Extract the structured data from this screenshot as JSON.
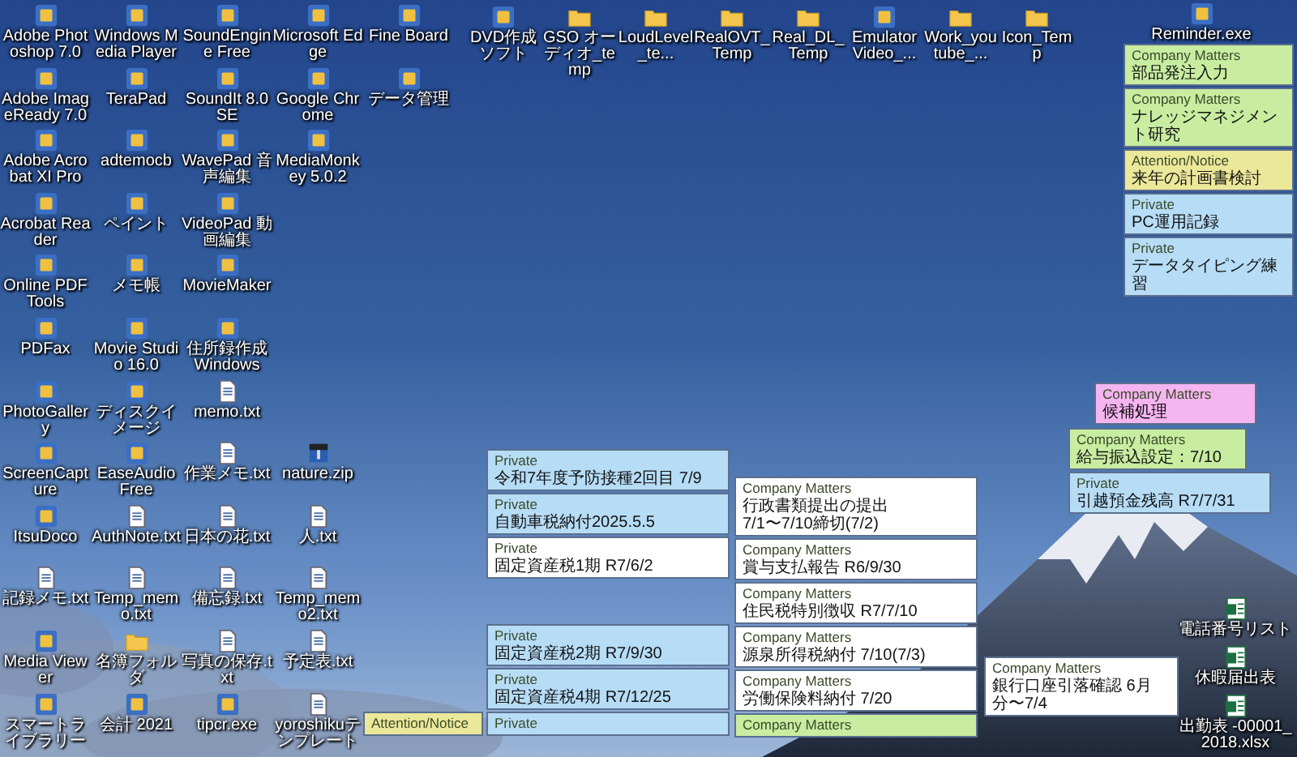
{
  "desktop_icons": {
    "left_grid": [
      [
        {
          "label": "Adobe Photoshop 7.0",
          "kind": "app"
        },
        {
          "label": "Windows Media Player",
          "kind": "app"
        },
        {
          "label": "SoundEngine Free",
          "kind": "app"
        },
        {
          "label": "Microsoft Edge",
          "kind": "app"
        },
        {
          "label": "Fine Board",
          "kind": "app"
        }
      ],
      [
        {
          "label": "Adobe ImageReady 7.0",
          "kind": "app"
        },
        {
          "label": "TeraPad",
          "kind": "app"
        },
        {
          "label": "SoundIt 8.0 SE",
          "kind": "app"
        },
        {
          "label": "Google Chrome",
          "kind": "app"
        },
        {
          "label": "データ管理",
          "kind": "app"
        }
      ],
      [
        {
          "label": "Adobe Acrobat XI Pro",
          "kind": "app"
        },
        {
          "label": "adtemocb",
          "kind": "app"
        },
        {
          "label": "WavePad 音声編集",
          "kind": "app"
        },
        {
          "label": "MediaMonkey 5.0.2",
          "kind": "app"
        }
      ],
      [
        {
          "label": "Acrobat Reader",
          "kind": "app"
        },
        {
          "label": "ペイント",
          "kind": "app"
        },
        {
          "label": "VideoPad 動画編集",
          "kind": "app"
        }
      ],
      [
        {
          "label": "Online PDF Tools",
          "kind": "app"
        },
        {
          "label": "メモ帳",
          "kind": "app"
        },
        {
          "label": "MovieMaker",
          "kind": "app"
        }
      ],
      [
        {
          "label": "PDFax",
          "kind": "app"
        },
        {
          "label": "Movie Studio 16.0",
          "kind": "app"
        },
        {
          "label": "住所録作成 Windows",
          "kind": "app"
        }
      ],
      [
        {
          "label": "PhotoGallery",
          "kind": "app"
        },
        {
          "label": "ディスクイメージ",
          "kind": "app"
        },
        {
          "label": "memo.txt",
          "kind": "text"
        }
      ],
      [
        {
          "label": "ScreenCapture",
          "kind": "app"
        },
        {
          "label": "EaseAudio Free",
          "kind": "app"
        },
        {
          "label": "作業メモ.txt",
          "kind": "text"
        },
        {
          "label": "nature.zip",
          "kind": "archive"
        }
      ],
      [
        {
          "label": "ItsuDoco",
          "kind": "app"
        },
        {
          "label": "AuthNote.txt",
          "kind": "text"
        },
        {
          "label": "日本の花.txt",
          "kind": "text"
        },
        {
          "label": "人.txt",
          "kind": "text"
        }
      ],
      [
        {
          "label": "記録メモ.txt",
          "kind": "text"
        },
        {
          "label": "Temp_memo.txt",
          "kind": "text"
        },
        {
          "label": "備忘録.txt",
          "kind": "text"
        },
        {
          "label": "Temp_memo2.txt",
          "kind": "text"
        }
      ],
      [
        {
          "label": "Media Viewer",
          "kind": "app"
        },
        {
          "label": "名簿フォルダ",
          "kind": "folder"
        },
        {
          "label": "写真の保存.txt",
          "kind": "text"
        },
        {
          "label": "予定表.txt",
          "kind": "text"
        }
      ],
      [
        {
          "label": "スマートライブラリー",
          "kind": "app"
        },
        {
          "label": "会計 2021",
          "kind": "app"
        },
        {
          "label": "tipcr.exe",
          "kind": "app"
        },
        {
          "label": "yoroshikuテンプレート",
          "kind": "text"
        }
      ]
    ],
    "top_row": [
      {
        "label": "DVD作成ソフト",
        "kind": "app"
      },
      {
        "label": "GSO オーディオ_temp",
        "kind": "folder"
      },
      {
        "label": "LoudLevel_te...",
        "kind": "folder"
      },
      {
        "label": "RealOVT_Temp",
        "kind": "folder"
      },
      {
        "label": "Real_DL_Temp",
        "kind": "folder"
      },
      {
        "label": "Emulator Video_...",
        "kind": "app"
      },
      {
        "label": "Work_youtube_...",
        "kind": "folder"
      },
      {
        "label": "Icon_Temp",
        "kind": "folder"
      }
    ],
    "right_top": [
      {
        "label": "Reminder.exe",
        "kind": "app"
      }
    ],
    "right_bottom": [
      {
        "label": "電話番号リスト",
        "kind": "sheet"
      },
      {
        "label": "休暇届出表",
        "kind": "sheet"
      },
      {
        "label": "出勤表 -00001_2018.xlsx",
        "kind": "sheet"
      }
    ]
  },
  "sticky_notes": [
    {
      "category": "Attention/Notice",
      "color": "#ece89a"
    },
    {
      "category": "Private",
      "lines": [
        "令和7年度予防接種2回目 7/9"
      ],
      "color": "#b6dcf6"
    },
    {
      "category": "Private",
      "lines": [
        "自動車税納付2025.5.5"
      ],
      "color": "#b6dcf6"
    },
    {
      "category": "Private",
      "lines": [
        "固定資産税1期 R7/6/2"
      ],
      "color": "#ffffff"
    },
    {
      "category": "Private",
      "lines": [
        "固定資産税2期 R7/9/30"
      ],
      "color": "#b6dcf6"
    },
    {
      "category": "Private",
      "lines": [
        "固定資産税4期 R7/12/25"
      ],
      "color": "#b6dcf6"
    },
    {
      "category": "Private",
      "color": "#b6dcf6"
    },
    {
      "category": "Company Matters",
      "lines": [
        "行政書類提出の提出",
        "7/1〜7/10締切(7/2)"
      ],
      "color": "#ffffff"
    },
    {
      "category": "Company Matters",
      "lines": [
        "賞与支払報告 R6/9/30"
      ],
      "color": "#ffffff"
    },
    {
      "category": "Company Matters",
      "lines": [
        "住民税特別徴収 R7/7/10"
      ],
      "color": "#ffffff"
    },
    {
      "category": "Company Matters",
      "lines": [
        "源泉所得税納付 7/10(7/3)"
      ],
      "color": "#ffffff"
    },
    {
      "category": "Company Matters",
      "lines": [
        "労働保険料納付 7/20"
      ],
      "color": "#ffffff"
    },
    {
      "category": "Company Matters",
      "color": "#c8eda0"
    },
    {
      "category": "Company Matters",
      "lines": [
        "部品発注入力"
      ],
      "color": "#c8eda0"
    },
    {
      "category": "Company Matters",
      "lines": [
        "ナレッジマネジメント研究"
      ],
      "color": "#c8eda0"
    },
    {
      "category": "Attention/Notice",
      "lines": [
        "来年の計画書検討"
      ],
      "color": "#ece89a"
    },
    {
      "category": "Private",
      "lines": [
        "PC運用記録"
      ],
      "color": "#b6dcf6"
    },
    {
      "category": "Private",
      "lines": [
        "データタイピング練習"
      ],
      "color": "#b6dcf6"
    },
    {
      "category": "Company Matters",
      "lines": [
        "候補処理"
      ],
      "color": "#f5b5f0"
    },
    {
      "category": "Company Matters",
      "lines": [
        "給与振込設定：7/10"
      ],
      "color": "#c8eda0"
    },
    {
      "category": "Private",
      "lines": [
        "引越預金残高 R7/7/31"
      ],
      "color": "#b6dcf6"
    },
    {
      "category": "Company Matters",
      "lines": [
        "銀行口座引落確認 6月分〜7/4"
      ],
      "color": "#ffffff"
    }
  ]
}
